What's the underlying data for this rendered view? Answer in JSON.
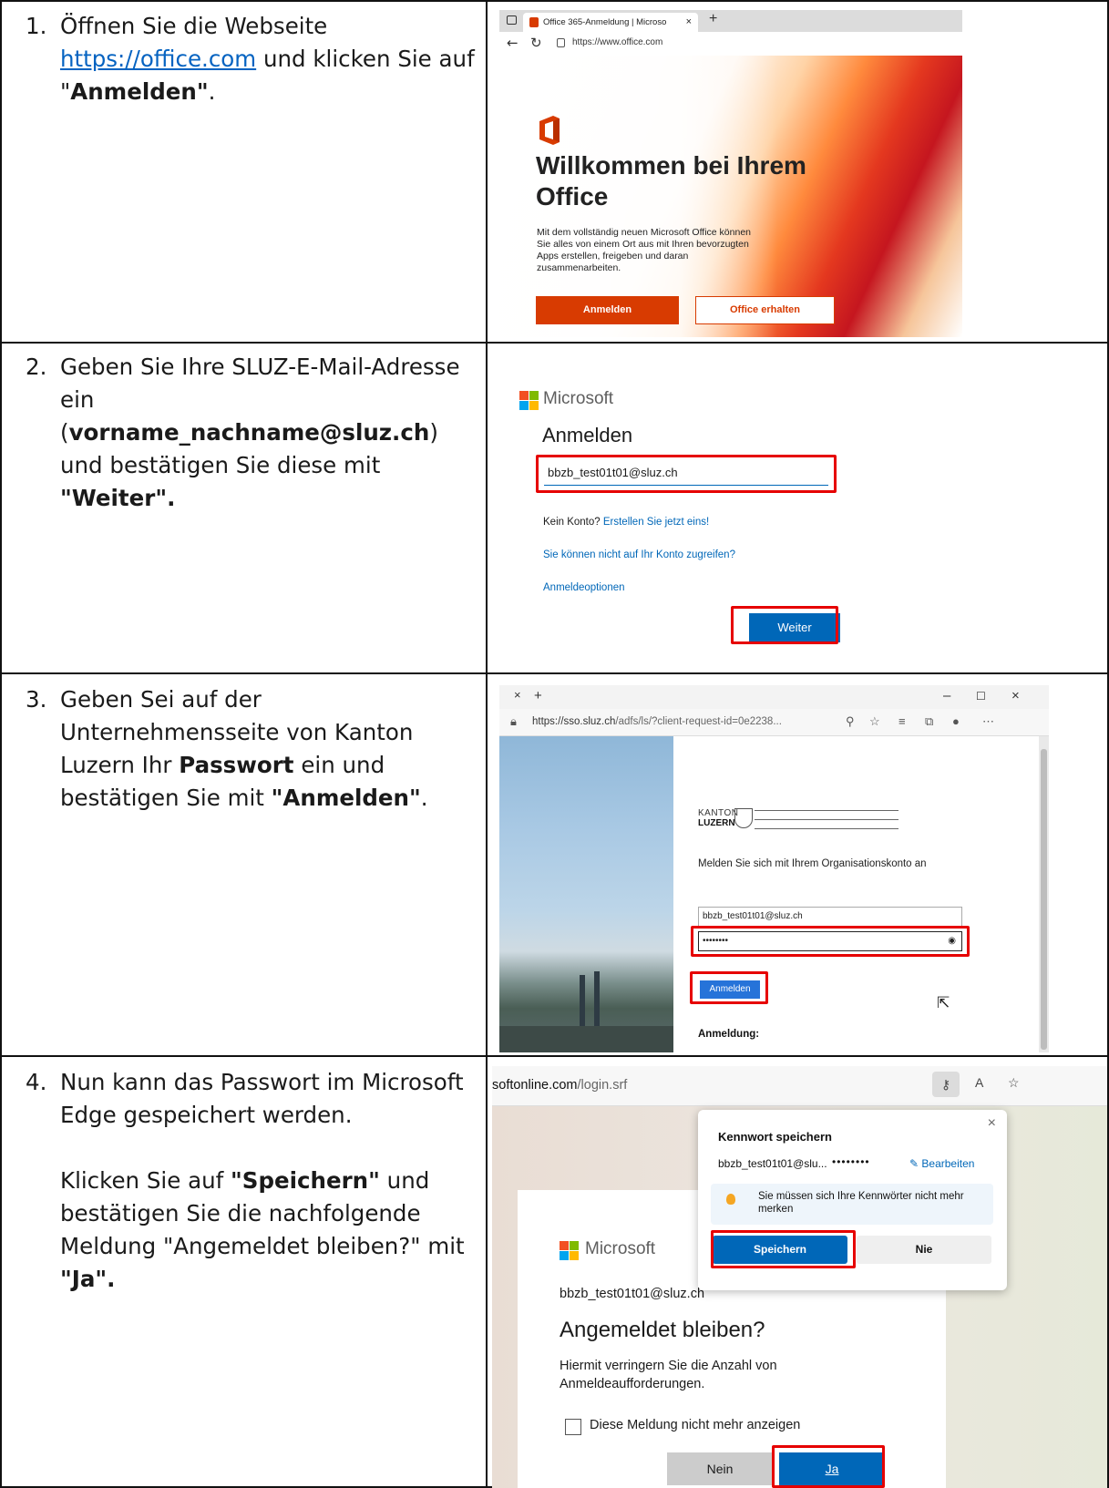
{
  "steps": [
    {
      "num": "1.",
      "t1": "Öffnen Sie die Webseite ",
      "link": "https://office.com",
      "t2": " und klicken Sie auf \"",
      "b1": "Anmelden\"",
      "t3": "."
    },
    {
      "num": "2.",
      "t1": "Geben Sie Ihre SLUZ-E-Mail-Adresse ein (",
      "b1": "vorname_nachname@sluz.ch",
      "t2": ") und bestätigen Sie diese mit ",
      "b2": "\"Weiter\"."
    },
    {
      "num": "3.",
      "t1": "Geben Sei auf der Unternehmensseite von Kanton Luzern Ihr ",
      "b1": "Passwort",
      "t2": " ein und bestätigen Sie mit ",
      "b2": "\"Anmelden\"",
      "t3": "."
    },
    {
      "num": "4.",
      "p1": "Nun kann das Passwort im Microsoft Edge gespeichert werden.",
      "t1": "Klicken Sie auf ",
      "b1": "\"Speichern\"",
      "t2": " und bestätigen Sie die nachfolgende Meldung \"Angemeldet bleiben?\" mit ",
      "b2": "\"Ja\"."
    }
  ],
  "shot1": {
    "tab_title": "Office 365-Anmeldung | Microso",
    "url": "https://www.office.com",
    "headline": "Willkommen bei Ihrem Office",
    "body": "Mit dem vollständig neuen Microsoft Office können Sie alles von einem Ort aus mit Ihren bevorzugten Apps erstellen, freigeben und daran zusammenarbeiten.",
    "signin_button": "Anmelden",
    "get_office_button": "Office erhalten"
  },
  "shot2": {
    "brand": "Microsoft",
    "title": "Anmelden",
    "email_value": "bbzb_test01t01@sluz.ch",
    "no_account": "Kein Konto? ",
    "create_link": "Erstellen Sie jetzt eins!",
    "cant_access_link": "Sie können nicht auf Ihr Konto zugreifen?",
    "options_link": "Anmeldeoptionen",
    "next_button": "Weiter"
  },
  "shot3": {
    "url_host": "https://sso.sluz.ch",
    "url_path": "/adfs/ls/?client-request-id=0e2238...",
    "logo_line1": "KANTON",
    "logo_line2": "LUZERN",
    "prompt": "Melden Sie sich mit Ihrem Organisationskonto an",
    "user_value": "bbzb_test01t01@sluz.ch",
    "password_value": "••••••••",
    "signin_button": "Anmelden",
    "footer_label": "Anmeldung:"
  },
  "shot4": {
    "url_domain": "softonline.com",
    "url_path": "/login.srf",
    "popup_title": "Kennwort speichern",
    "popup_user": "bbzb_test01t01@slu...",
    "popup_dots": "••••••••",
    "popup_edit": "Bearbeiten",
    "popup_tip": "Sie müssen sich Ihre Kennwörter nicht mehr merken",
    "save_button": "Speichern",
    "never_button": "Nie",
    "brand": "Microsoft",
    "email": "bbzb_test01t01@sluz.ch",
    "title": "Angemeldet bleiben?",
    "description": "Hiermit verringern Sie die Anzahl von Anmeldeaufforderungen.",
    "checkbox_label": "Diese Meldung nicht mehr anzeigen",
    "no_button": "Nein",
    "yes_button": "Ja"
  },
  "colors": {
    "office_red": "#d83b01",
    "ms_blue": "#0067b8",
    "highlight_red": "#e60000"
  }
}
